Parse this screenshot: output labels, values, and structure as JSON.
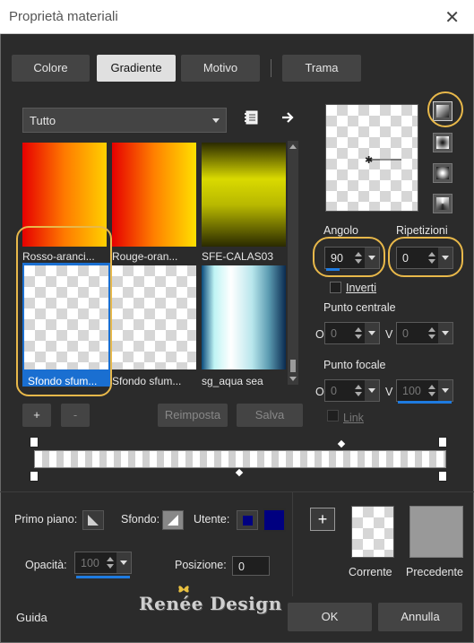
{
  "window": {
    "title": "Proprietà materiali",
    "close": "✕"
  },
  "tabs": [
    {
      "label": "Colore",
      "active": false
    },
    {
      "label": "Gradiente",
      "active": true
    },
    {
      "label": "Motivo",
      "active": false
    },
    {
      "label": "Trama",
      "active": false
    }
  ],
  "category": {
    "value": "Tutto"
  },
  "gradients": [
    {
      "label": "Rosso-aranci...",
      "colors": [
        "#e60000",
        "#ffd000"
      ]
    },
    {
      "label": "Rouge-oran...",
      "colors": [
        "#e60000",
        "#ffe000"
      ]
    },
    {
      "label": "SFE-CALAS03",
      "colors": [
        "#dada00",
        "#2a2a00"
      ]
    },
    {
      "label": "Sfondo sfum...",
      "colors": [
        "transparent"
      ],
      "selected": true
    },
    {
      "label": "Sfondo sfum...",
      "colors": [
        "transparent"
      ]
    },
    {
      "label": "sg_aqua sea",
      "colors": [
        "#0a4a7a",
        "#e8ffff",
        "#b8e6ec",
        "#0a2a50"
      ]
    }
  ],
  "buttons": {
    "add": "+",
    "remove": "-",
    "reset": "Reimposta",
    "save": "Salva",
    "ok": "OK",
    "cancel": "Annulla",
    "help": "Guida"
  },
  "angle": {
    "label": "Angolo",
    "value": "90"
  },
  "repeats": {
    "label": "Ripetizioni",
    "value": "0"
  },
  "invert": {
    "label": "Inverti",
    "checked": false
  },
  "center": {
    "label": "Punto centrale",
    "o_label": "O",
    "o_value": "0",
    "v_label": "V",
    "v_value": "0"
  },
  "focal": {
    "label": "Punto focale",
    "o_label": "O",
    "o_value": "0",
    "v_label": "V",
    "v_value": "100"
  },
  "link": {
    "label": "Link",
    "checked": false
  },
  "bottom": {
    "foreground_label": "Primo piano:",
    "background_label": "Sfondo:",
    "user_label": "Utente:",
    "user_color": "#000080",
    "opacity_label": "Opacità:",
    "opacity_value": "100",
    "position_label": "Posizione:",
    "position_value": "0",
    "current_label": "Corrente",
    "previous_label": "Precedente",
    "add_stop": "+",
    "watermark": "Renée Design"
  },
  "highlight_color": "#e8b84a",
  "accent_color": "#1e7be0"
}
